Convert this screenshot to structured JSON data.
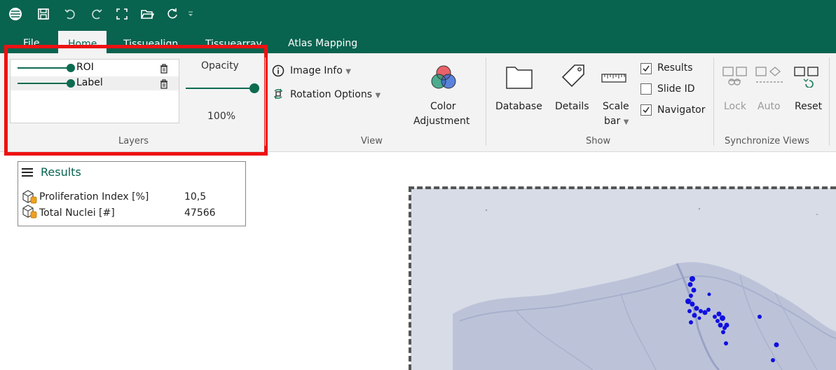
{
  "quick_access": {
    "icons": [
      "app-logo-icon",
      "save-icon",
      "undo-icon",
      "redo-icon",
      "fullscreen-icon",
      "open-folder-icon",
      "refresh-icon",
      "customize-dropdown-icon"
    ]
  },
  "tabs": [
    {
      "label": "File"
    },
    {
      "label": "Home"
    },
    {
      "label": "Tissuealign"
    },
    {
      "label": "Tissuearray"
    },
    {
      "label": "Atlas Mapping"
    }
  ],
  "layers": {
    "items": [
      {
        "name": "ROI"
      },
      {
        "name": "Label"
      }
    ],
    "opacity_label": "Opacity",
    "opacity_value": "100%",
    "opacity_level": 1.0,
    "group_label": "Layers"
  },
  "view": {
    "image_info": "Image Info",
    "rotation_options": "Rotation Options",
    "color_adjustment_line1": "Color",
    "color_adjustment_line2": "Adjustment",
    "group_label": "View"
  },
  "show": {
    "database": "Database",
    "details": "Details",
    "scale_bar_line1": "Scale",
    "scale_bar_line2": "bar",
    "checks": [
      {
        "label": "Results",
        "checked": true
      },
      {
        "label": "Slide ID",
        "checked": false
      },
      {
        "label": "Navigator",
        "checked": true
      }
    ],
    "group_label": "Show"
  },
  "sync": {
    "lock": "Lock",
    "auto": "Auto",
    "reset": "Reset",
    "group_label": "Synchronize Views"
  },
  "results": {
    "title": "Results",
    "rows": [
      {
        "label": "Proliferation Index [%]",
        "value": "10,5"
      },
      {
        "label": "Total Nuclei [#]",
        "value": "47566"
      }
    ]
  },
  "colors": {
    "brand_green": "#08634f",
    "highlight_red": "#ee1111",
    "marker_blue": "#1010e0"
  }
}
